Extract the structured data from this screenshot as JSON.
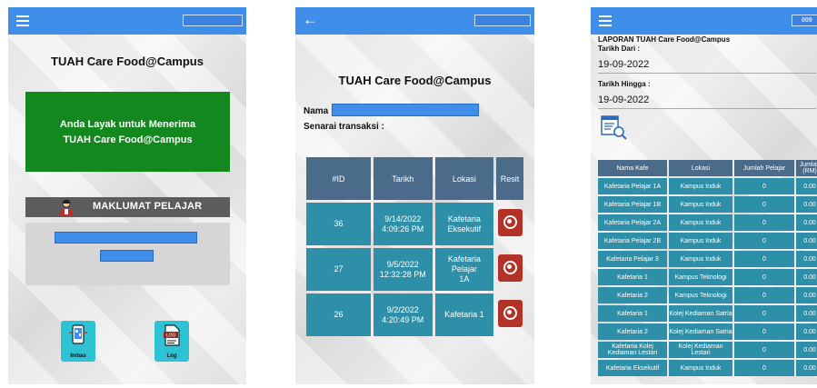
{
  "screen1": {
    "title": "TUAH Care Food@Campus",
    "eligibility_line1": "Anda Layak untuk Menerima",
    "eligibility_line2": "TUAH Care Food@Campus",
    "maklumat_label": "MAKLUMAT PELAJAR",
    "btn_imbas_label": "Imbas",
    "btn_log_label": "Log",
    "icon_names": [
      "menu-icon",
      "student-avatar-icon",
      "scan-phone-icon",
      "log-document-icon"
    ]
  },
  "screen2": {
    "title": "TUAH Care Food@Campus",
    "nama_label": "Nama :",
    "senarai_label": "Senarai transaksi :",
    "table": {
      "headers": [
        "#ID",
        "Tarikh",
        "Lokasi",
        "Resit"
      ],
      "rows": [
        {
          "id": "36",
          "date": "9/14/2022",
          "time": "4:09:26 PM",
          "lokasi1": "Kafetaria",
          "lokasi2": "Eksekutif"
        },
        {
          "id": "27",
          "date": "9/5/2022",
          "time": "12:32:28 PM",
          "lokasi1": "Kafetaria Pelajar",
          "lokasi2": "1A"
        },
        {
          "id": "26",
          "date": "9/2/2022",
          "time": "4:20:49 PM",
          "lokasi1": "Kafetaria 1",
          "lokasi2": ""
        }
      ]
    }
  },
  "screen3": {
    "header_partial": "009",
    "title": "LAPORAN TUAH Care Food@Campus",
    "tarikh_dari_label": "Tarikh Dari :",
    "tarikh_dari_value": "19-09-2022",
    "tarikh_hingga_label": "Tarikh Hingga :",
    "tarikh_hingga_value": "19-09-2022",
    "table": {
      "headers": [
        "Nama Kafe",
        "Lokasi",
        "Jumlah Pelajar",
        "Jumlah (RM)"
      ],
      "rows": [
        {
          "kafe": "Kafetaria Pelajar 1A",
          "lokasi": "Kampus Induk",
          "pelajar": "0",
          "rm": "0.00"
        },
        {
          "kafe": "Kafetaria Pelajar 1B",
          "lokasi": "Kampus Induk",
          "pelajar": "0",
          "rm": "0.00"
        },
        {
          "kafe": "Kafetaria Pelajar 2A",
          "lokasi": "Kampus Induk",
          "pelajar": "0",
          "rm": "0.00"
        },
        {
          "kafe": "Kafetaria Pelajar 2B",
          "lokasi": "Kampus Induk",
          "pelajar": "0",
          "rm": "0.00"
        },
        {
          "kafe": "Kafetaria Pelajar 3",
          "lokasi": "Kampus Induk",
          "pelajar": "0",
          "rm": "0.00"
        },
        {
          "kafe": "Kafetaria 1",
          "lokasi": "Kampus Teknologi",
          "pelajar": "0",
          "rm": "0.00"
        },
        {
          "kafe": "Kafetaria 2",
          "lokasi": "Kampus Teknologi",
          "pelajar": "0",
          "rm": "0.00"
        },
        {
          "kafe": "Kafetaria 1",
          "lokasi": "Kolej Kediaman Satria",
          "pelajar": "0",
          "rm": "0.00"
        },
        {
          "kafe": "Kafetaria 2",
          "lokasi": "Kolej Kediaman Satria",
          "pelajar": "0",
          "rm": "0.00"
        },
        {
          "kafe": "Kafetaria Kolej Kediaman Lestari",
          "lokasi": "Kolej Kediaman Lestari",
          "pelajar": "0",
          "rm": "0.00"
        },
        {
          "kafe": "Kafetaria Eksekutif",
          "lokasi": "Kampus Induk",
          "pelajar": "0",
          "rm": "0.00"
        }
      ]
    }
  },
  "colors": {
    "appbar": "#3f8ee9",
    "eligible_green": "#12881f",
    "table_header": "#4a6b8a",
    "table_cell": "#2e8fa8",
    "resit_red": "#b23228",
    "icon_teal": "#2dc2d4"
  }
}
